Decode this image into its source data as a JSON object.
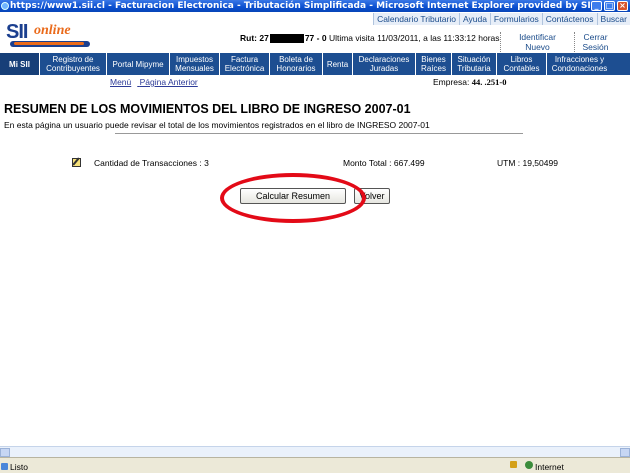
{
  "window": {
    "title": "https://www1.sii.cl - Facturacion Electronica - Tributación Simplificada - Microsoft Internet Explorer provided by SII"
  },
  "top_nav": [
    "Calendario Tributario",
    "Ayuda",
    "Formularios",
    "Contáctenos",
    "Buscar"
  ],
  "header": {
    "rut_label": "Rut: 27",
    "rut_suffix": "77 - 0",
    "last_visit": "Ultima visita 11/03/2011, a las 11:33:12 horas",
    "identify_link": "Identificar Nuevo Contribuyente",
    "logout_link": "Cerrar Sesión"
  },
  "menu": [
    "Mi SII",
    "Registro de Contribuyentes",
    "Portal Mipyme",
    "Impuestos Mensuales",
    "Factura Electrónica",
    "Boleta de Honorarios",
    "Renta",
    "Declaraciones Juradas",
    "Bienes Raíces",
    "Situación Tributaria",
    "Libros Contables",
    "Infracciones y Condonaciones"
  ],
  "subnav": {
    "menu_link": "Menú",
    "back_link": "Página Anterior",
    "company_label": "Empresa:",
    "company_value": "44.   .251-0"
  },
  "content": {
    "title": "RESUMEN DE LOS MOVIMIENTOS DEL LIBRO DE INGRESO 2007-01",
    "description": "En esta página un usuario puede revisar el total de los movimientos registrados en el libro de INGRESO 2007-01",
    "transactions": "Cantidad de Transacciones : 3",
    "total": "Monto Total : 667.499",
    "utm": "UTM : 19,50499",
    "calc_button": "Calcular Resumen",
    "back_button": "Volver"
  },
  "status": {
    "left": "Listo",
    "right": "Internet"
  },
  "colors": {
    "menu_bg": "#1d4e91",
    "annotation": "#e30a17"
  }
}
